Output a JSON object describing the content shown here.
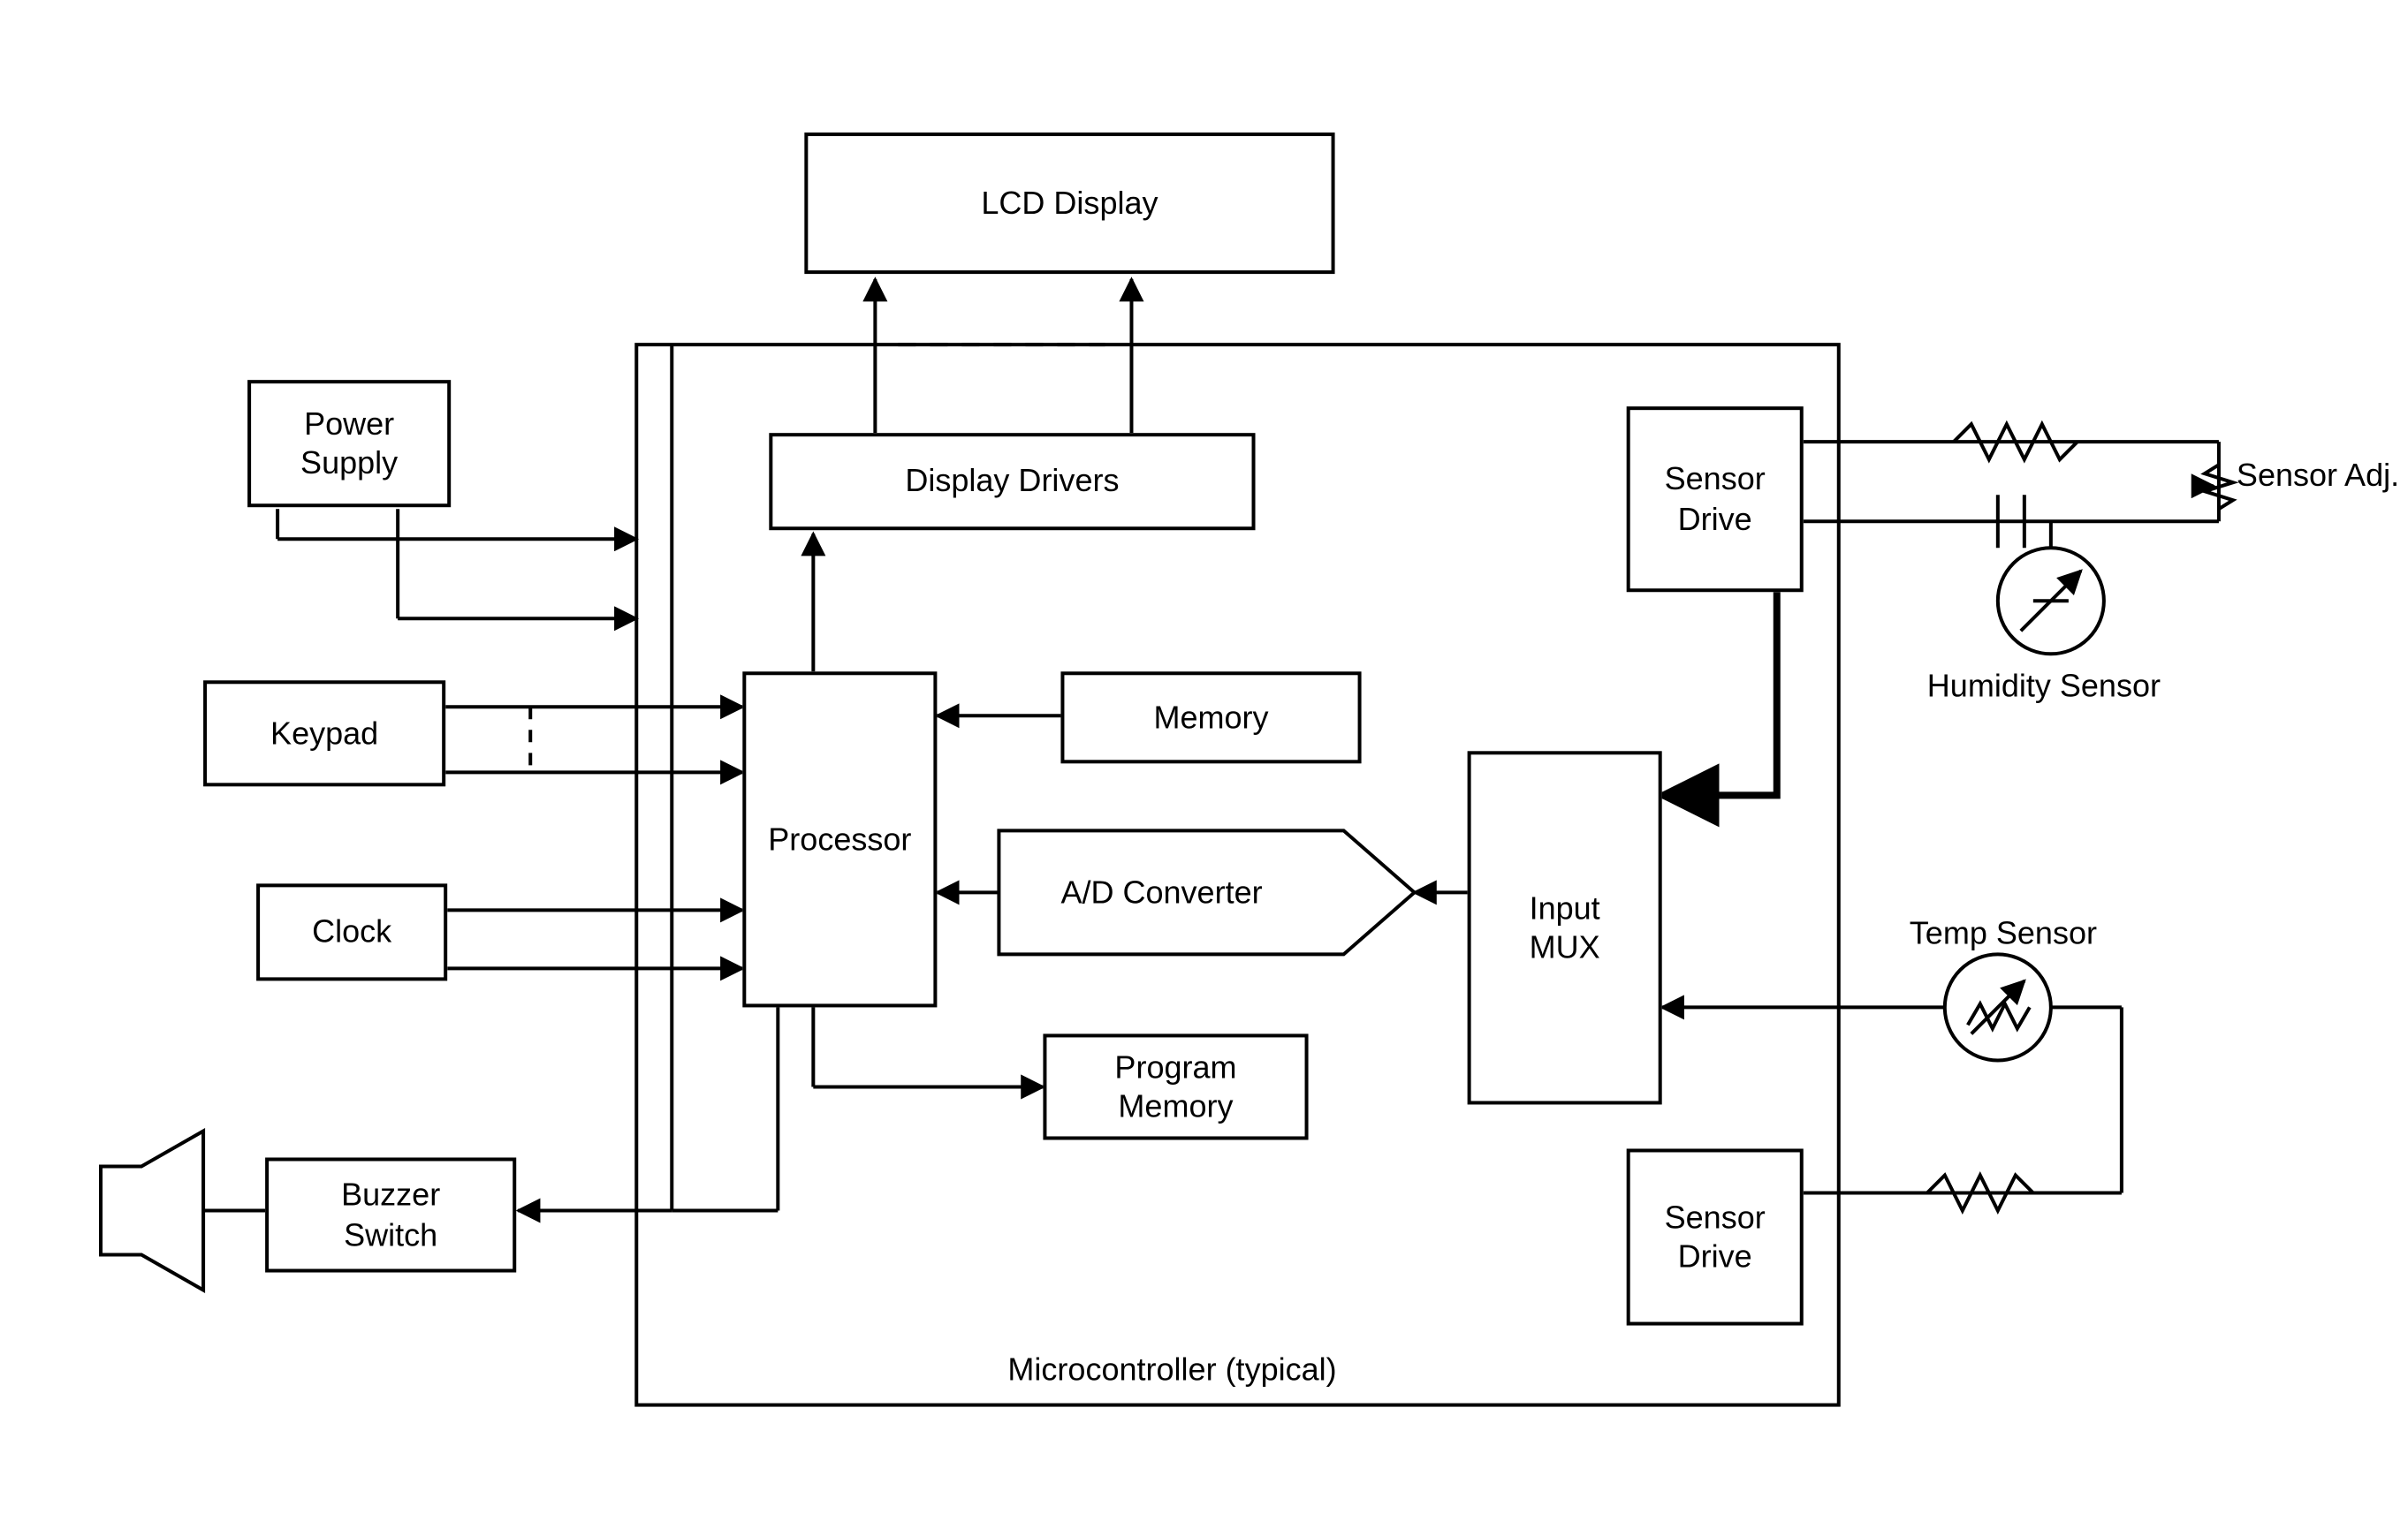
{
  "blocks": {
    "lcd_display": "LCD Display",
    "power_supply": "Power\nSupply",
    "display_drivers": "Display Drivers",
    "sensor_drive_top": "Sensor\nDrive",
    "sensor_adj": "Sensor\nAdj.",
    "humidity_sensor": "Humidity Sensor",
    "keypad": "Keypad",
    "memory": "Memory",
    "processor": "Processor",
    "ad_converter": "A/D Converter",
    "input_mux": "Input\nMUX",
    "clock": "Clock",
    "program_memory": "Program\nMemory",
    "temp_sensor": "Temp Sensor",
    "buzzer_switch": "Buzzer\nSwitch",
    "sensor_drive_bottom": "Sensor\nDrive",
    "microcontroller": "Microcontroller (typical)"
  }
}
